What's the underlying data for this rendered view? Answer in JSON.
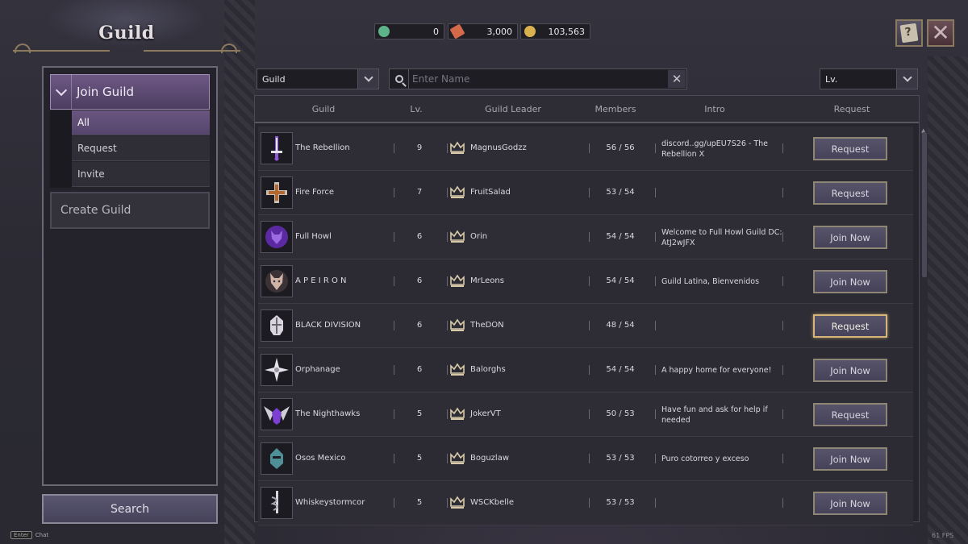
{
  "header": {
    "title": "Guild"
  },
  "currencies": [
    {
      "icon": "crystal-icon",
      "value": "0",
      "color": "#5db38a"
    },
    {
      "icon": "ticket-icon",
      "value": "3,000",
      "color": "#d46a4a"
    },
    {
      "icon": "gold-coin-icon",
      "value": "103,563",
      "color": "#d9b04e"
    }
  ],
  "sidebar": {
    "join_label": "Join Guild",
    "sub_items": [
      {
        "label": "All",
        "active": true
      },
      {
        "label": "Request",
        "active": false
      },
      {
        "label": "Invite",
        "active": false
      }
    ],
    "create_label": "Create Guild",
    "search_label": "Search"
  },
  "filters": {
    "type_value": "Guild",
    "name_placeholder": "Enter Name",
    "level_value": "Lv."
  },
  "table": {
    "headers": [
      "Guild",
      "Lv.",
      "Guild Leader",
      "Members",
      "Intro",
      "Request"
    ],
    "rows": [
      {
        "emblem": "sword-emblem-icon",
        "name": "The Rebellion",
        "level": "9",
        "leader": "MagnusGodzz",
        "members": "56 / 56",
        "intro": "discord..gg/upEU7S26 - The Rebellion X",
        "action": "Request",
        "highlight": false
      },
      {
        "emblem": "cross-emblem-icon",
        "name": "Fire Force",
        "level": "7",
        "leader": "FruitSalad",
        "members": "53 / 54",
        "intro": "",
        "action": "Request",
        "highlight": false
      },
      {
        "emblem": "wolf-emblem-icon",
        "name": "Full Howl",
        "level": "6",
        "leader": "Orin",
        "members": "54 / 54",
        "intro": "Welcome to Full Howl Guild DC: AtJ2wJFX",
        "action": "Join Now",
        "highlight": false
      },
      {
        "emblem": "wolf-head-emblem-icon",
        "name": "A P E I R O N",
        "level": "6",
        "leader": "MrLeons",
        "members": "54 / 54",
        "intro": "Guild Latina, Bienvenidos",
        "action": "Join Now",
        "highlight": false
      },
      {
        "emblem": "helmet-emblem-icon",
        "name": "BLACK DIVISION",
        "level": "6",
        "leader": "TheDON",
        "members": "48 / 54",
        "intro": "",
        "action": "Request",
        "highlight": true
      },
      {
        "emblem": "star-emblem-icon",
        "name": "Orphanage",
        "level": "6",
        "leader": "Balorghs",
        "members": "54 / 54",
        "intro": "A happy home for everyone!",
        "action": "Join Now",
        "highlight": false
      },
      {
        "emblem": "winged-emblem-icon",
        "name": "The Nighthawks",
        "level": "5",
        "leader": "JokerVT",
        "members": "50 / 53",
        "intro": "Have fun and ask for help if needed",
        "action": "Request",
        "highlight": false
      },
      {
        "emblem": "teal-helmet-emblem-icon",
        "name": "Osos Mexico",
        "level": "5",
        "leader": "Boguzlaw",
        "members": "53 / 53",
        "intro": "Puro cotorreo y exceso",
        "action": "Join Now",
        "highlight": false
      },
      {
        "emblem": "serpent-sword-emblem-icon",
        "name": "Whiskeystormcor",
        "level": "5",
        "leader": "WSCKbelle",
        "members": "53 / 53",
        "intro": "",
        "action": "Join Now",
        "highlight": false
      }
    ]
  },
  "footer": {
    "enter_key": "Enter",
    "chat_label": "Chat",
    "fps": "61 FPS"
  }
}
